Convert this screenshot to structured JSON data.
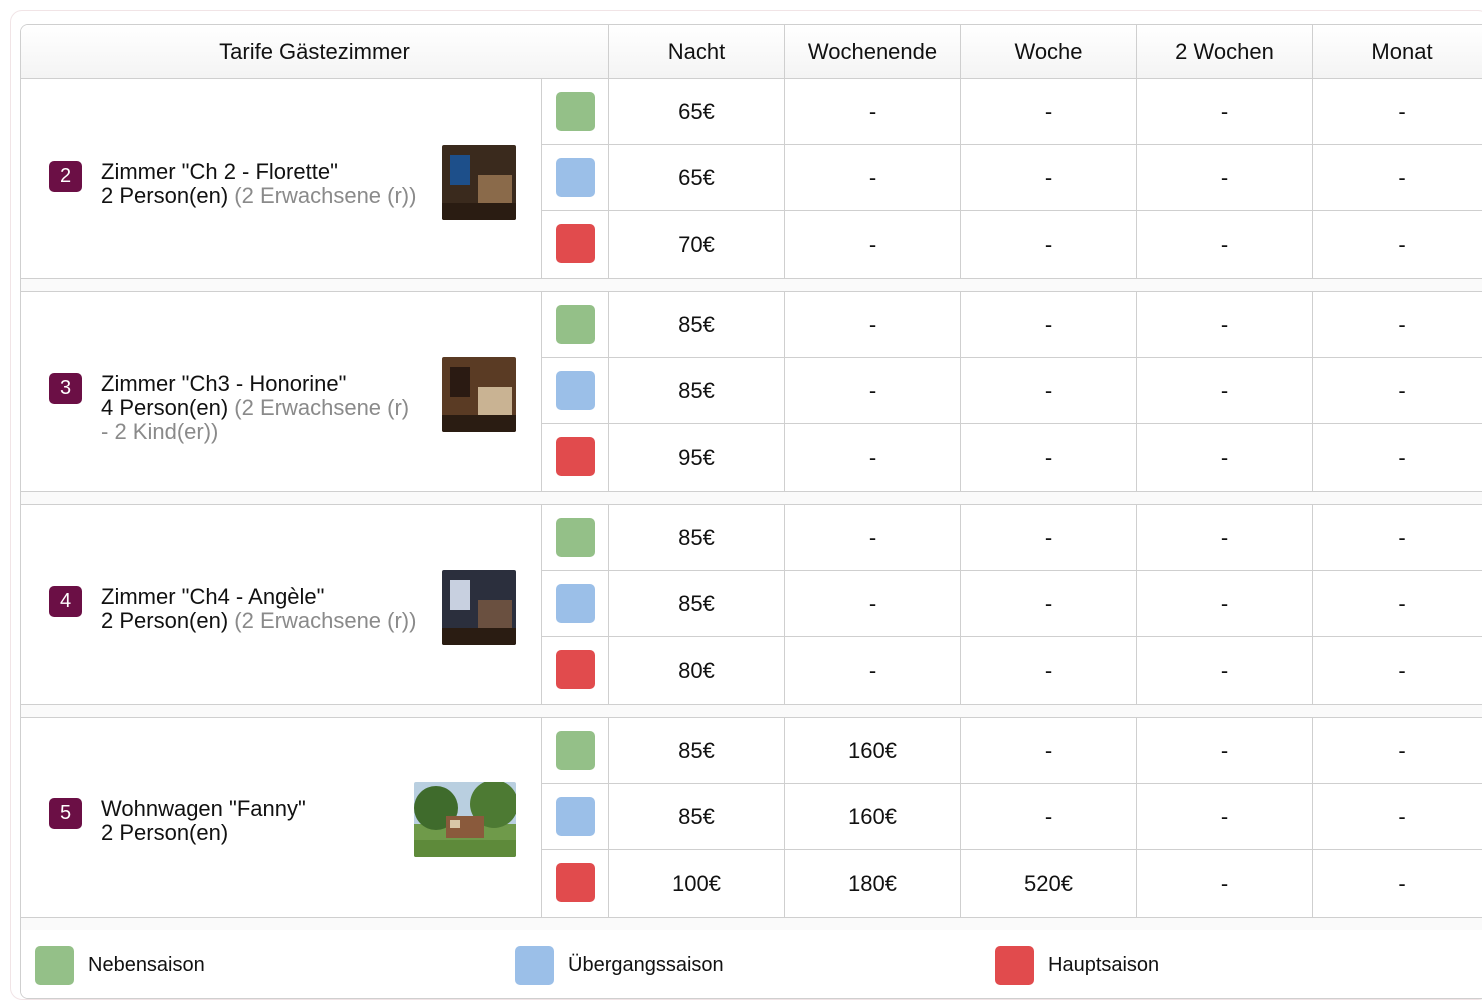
{
  "header": {
    "title": "Tarife Gästezimmer",
    "columns": [
      "Nacht",
      "Wochenende",
      "Woche",
      "2 Wochen",
      "Monat"
    ]
  },
  "colors": {
    "green": "#94c088",
    "blue": "#9bbfe8",
    "red": "#e14b4d",
    "badge": "#6b0f45"
  },
  "seasons": [
    {
      "key": "green",
      "label": "Nebensaison"
    },
    {
      "key": "blue",
      "label": "Übergangssaison"
    },
    {
      "key": "red",
      "label": "Hauptsaison"
    }
  ],
  "rooms": [
    {
      "number": "2",
      "name": "Zimmer \"Ch 2 - Florette\"",
      "persons": "2 Person(en)",
      "detail": " (2 Erwachsene (r))",
      "photo": "bedroom-photo",
      "rates": [
        [
          "65€",
          "-",
          "-",
          "-",
          "-"
        ],
        [
          "65€",
          "-",
          "-",
          "-",
          "-"
        ],
        [
          "70€",
          "-",
          "-",
          "-",
          "-"
        ]
      ]
    },
    {
      "number": "3",
      "name": "Zimmer \"Ch3  - Honorine\"",
      "persons": "4 Person(en)",
      "detail": " (2 Erwachsene (r) - 2 Kind(er))",
      "photo": "bedroom-photo",
      "rates": [
        [
          "85€",
          "-",
          "-",
          "-",
          "-"
        ],
        [
          "85€",
          "-",
          "-",
          "-",
          "-"
        ],
        [
          "95€",
          "-",
          "-",
          "-",
          "-"
        ]
      ]
    },
    {
      "number": "4",
      "name": "Zimmer \"Ch4  -  Angèle\"",
      "persons": "2 Person(en)",
      "detail": " (2 Erwachsene (r))",
      "photo": "bedroom-photo",
      "rates": [
        [
          "85€",
          "-",
          "-",
          "-",
          "-"
        ],
        [
          "85€",
          "-",
          "-",
          "-",
          "-"
        ],
        [
          "80€",
          "-",
          "-",
          "-",
          "-"
        ]
      ]
    },
    {
      "number": "5",
      "name": "Wohnwagen \"Fanny\"",
      "persons": "2 Person(en)",
      "detail": "",
      "photo": "caravan-garden-photo",
      "rates": [
        [
          "85€",
          "160€",
          "-",
          "-",
          "-"
        ],
        [
          "85€",
          "160€",
          "-",
          "-",
          "-"
        ],
        [
          "100€",
          "180€",
          "520€",
          "-",
          "-"
        ]
      ]
    }
  ]
}
